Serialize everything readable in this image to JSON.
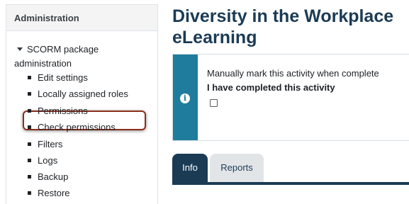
{
  "admin": {
    "header": "Administration",
    "package_title": "SCORM package administration",
    "items": [
      {
        "label": "Edit settings"
      },
      {
        "label": "Locally assigned roles",
        "highlighted": true
      },
      {
        "label": "Permissions"
      },
      {
        "label": "Check permissions"
      },
      {
        "label": "Filters"
      },
      {
        "label": "Logs"
      },
      {
        "label": "Backup"
      },
      {
        "label": "Restore"
      }
    ]
  },
  "main": {
    "title_line1": "Diversity in the Workplace",
    "title_line2": "eLearning",
    "completion": {
      "instruction": "Manually mark this activity when complete",
      "checkbox_label": "I have completed this activity",
      "checked": false,
      "icon": "info-icon"
    },
    "tabs": [
      {
        "label": "Info",
        "active": true
      },
      {
        "label": "Reports",
        "active": false
      }
    ]
  },
  "colors": {
    "highlight_border": "#8b2e1b",
    "title": "#1b3b55",
    "info_stripe": "#1f7c9c",
    "active_tab": "#1b3b55",
    "inactive_tab": "#e2e5e8"
  }
}
